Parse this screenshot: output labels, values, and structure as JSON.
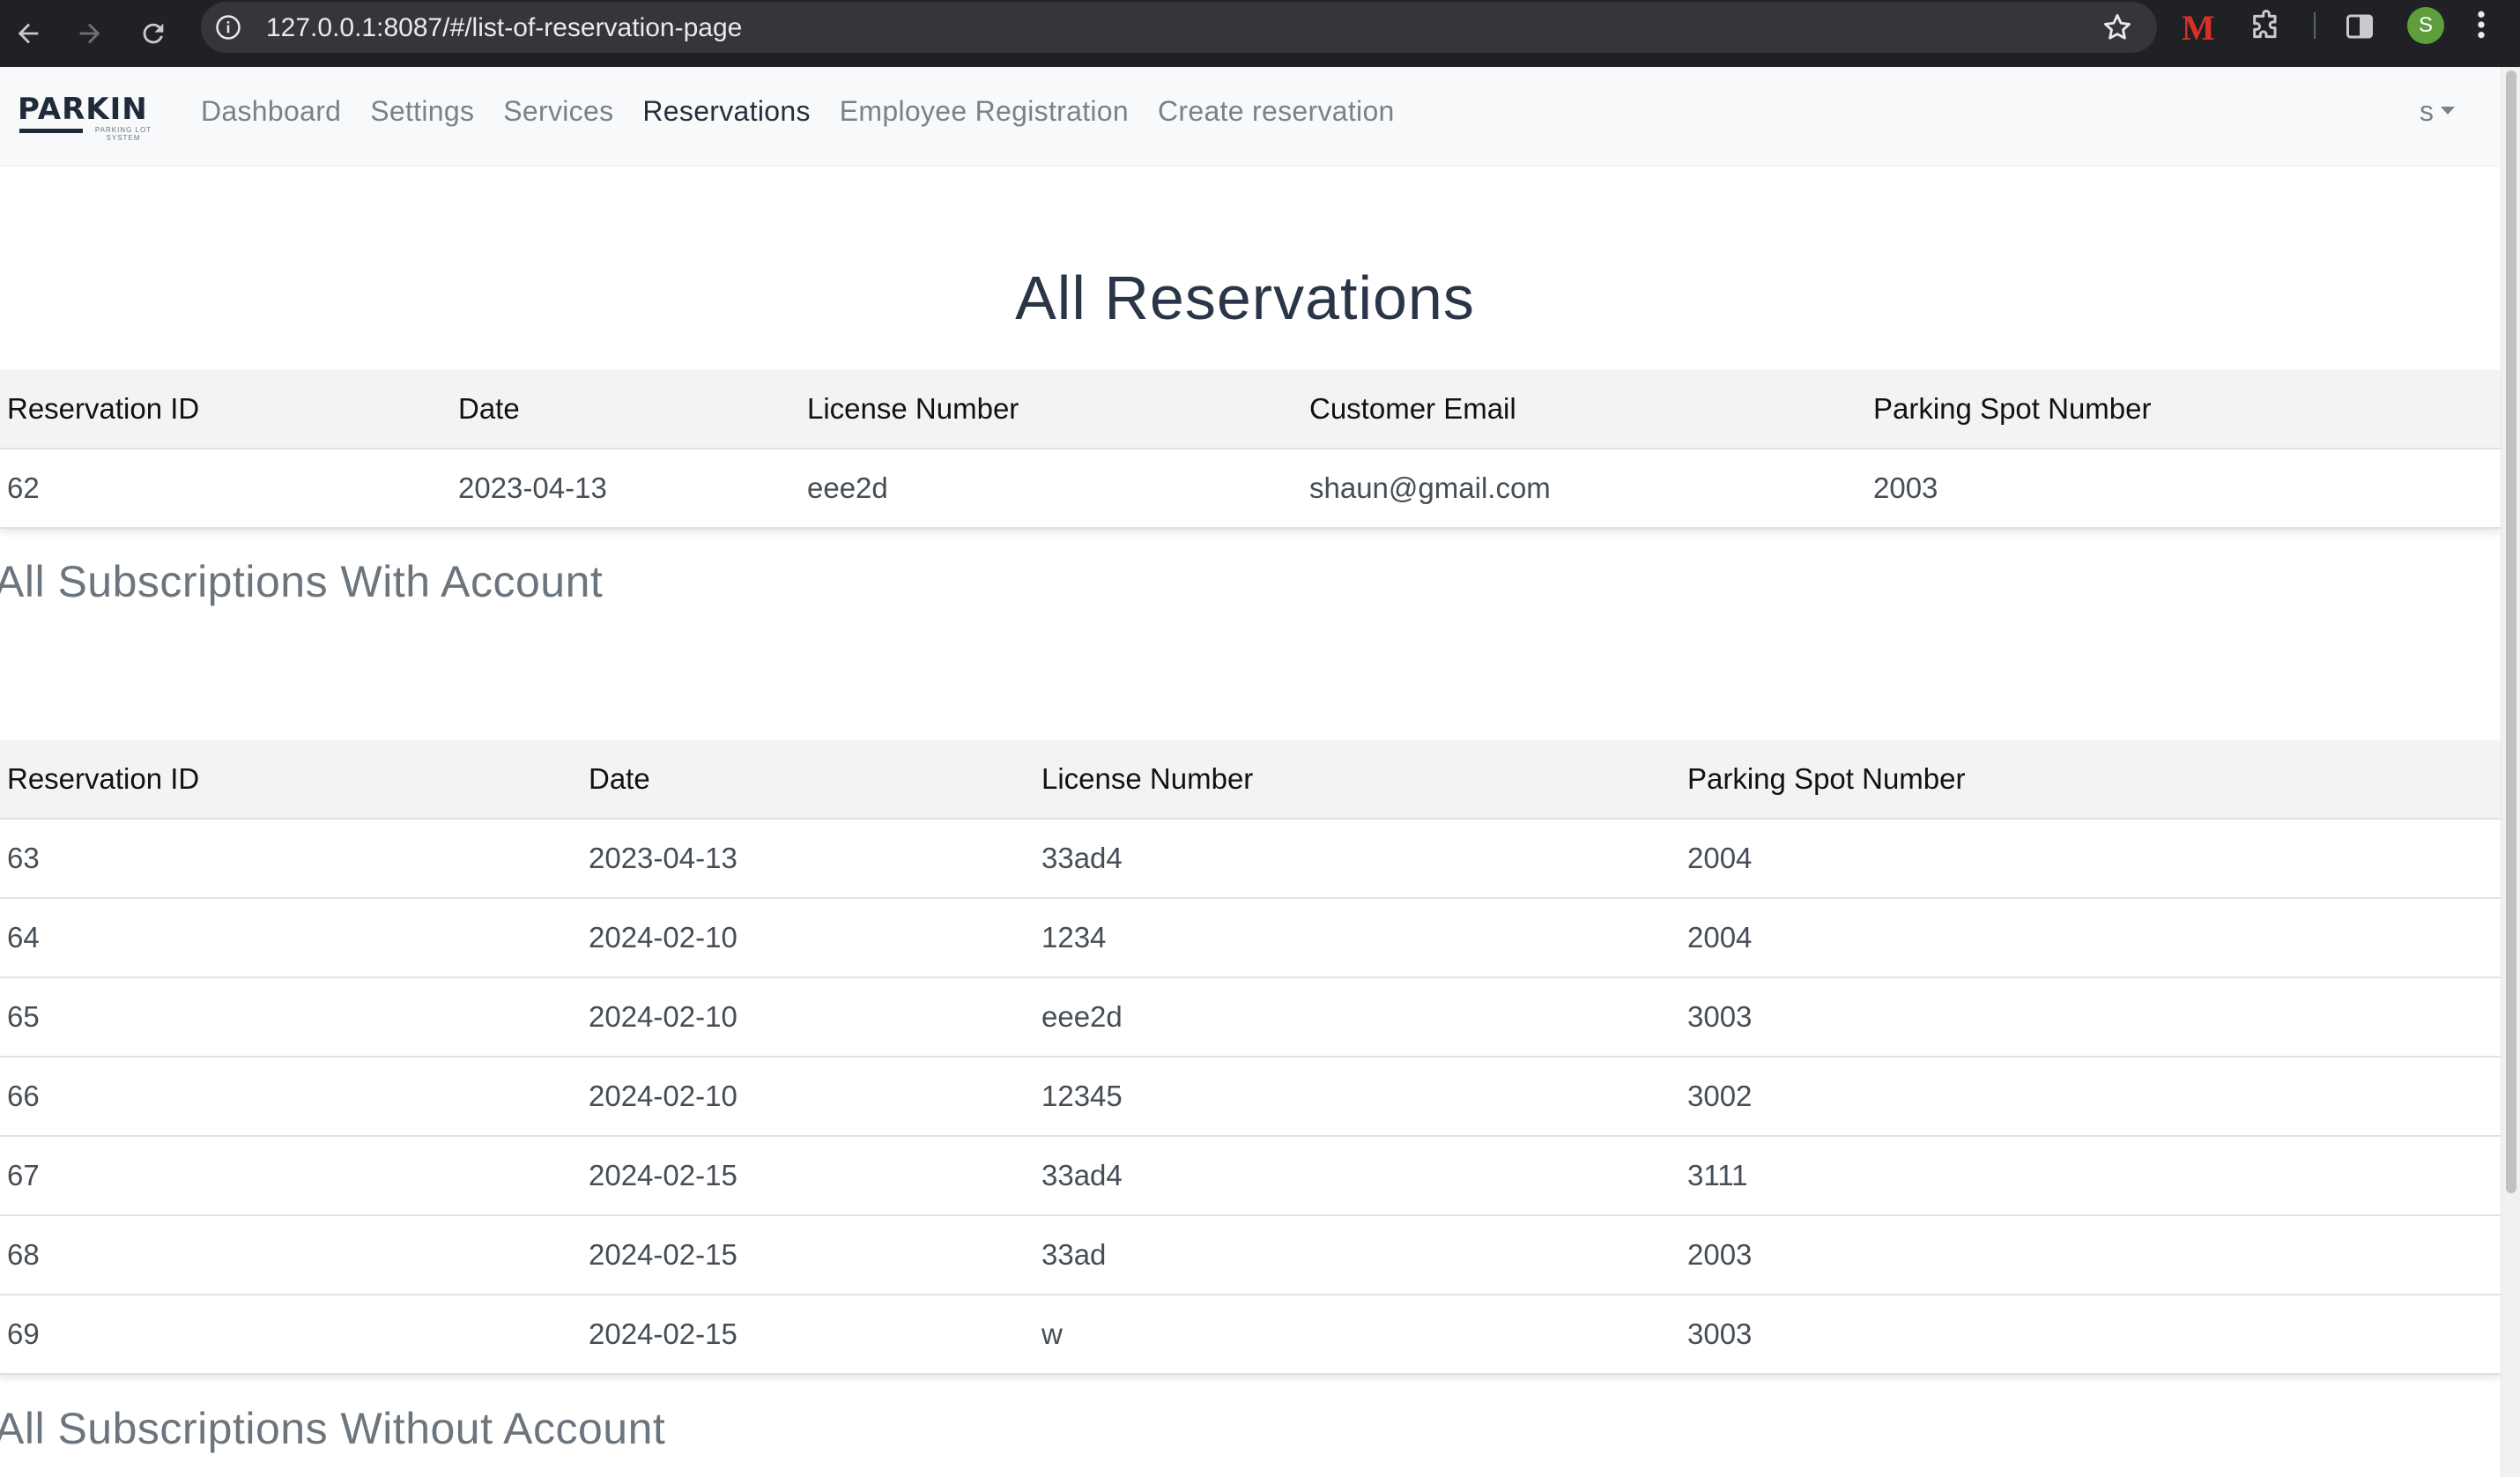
{
  "browser": {
    "url": "127.0.0.1:8087/#/list-of-reservation-page",
    "profile_initial": "S",
    "extension_letter": "M",
    "icons": [
      "back-arrow-icon",
      "forward-arrow-icon",
      "reload-icon",
      "site-info-icon",
      "bookmark-star-icon",
      "puzzle-extension-icon",
      "side-panel-icon",
      "kebab-menu-icon"
    ]
  },
  "navbar": {
    "brand": "PARKIN",
    "brand_tagline": "PARKING LOT SYSTEM",
    "links": [
      "Dashboard",
      "Settings",
      "Services",
      "Reservations",
      "Employee Registration",
      "Create reservation"
    ],
    "active": "Reservations",
    "user": "s"
  },
  "page_title": "All Reservations",
  "reservations_table": {
    "columns": [
      "Reservation ID",
      "Date",
      "License Number",
      "Customer Email",
      "Parking Spot Number"
    ],
    "rows": [
      [
        "62",
        "2023-04-13",
        "eee2d",
        "shaun@gmail.com",
        "2003"
      ]
    ]
  },
  "subs_with_account": {
    "title": "All Subscriptions With Account",
    "columns": [
      "Reservation ID",
      "Date",
      "License Number",
      "Parking Spot Number"
    ],
    "rows": [
      [
        "63",
        "2023-04-13",
        "33ad4",
        "2004"
      ],
      [
        "64",
        "2024-02-10",
        "1234",
        "2004"
      ],
      [
        "65",
        "2024-02-10",
        "eee2d",
        "3003"
      ],
      [
        "66",
        "2024-02-10",
        "12345",
        "3002"
      ],
      [
        "67",
        "2024-02-15",
        "33ad4",
        "3111"
      ],
      [
        "68",
        "2024-02-15",
        "33ad",
        "2003"
      ],
      [
        "69",
        "2024-02-15",
        "w",
        "3003"
      ]
    ]
  },
  "subs_without_account": {
    "title": "All Subscriptions Without Account"
  },
  "colors": {
    "chrome_bg": "#202124",
    "navbar_bg": "#f8f9fa",
    "heading": "#2a3647",
    "muted": "#6c757d"
  }
}
